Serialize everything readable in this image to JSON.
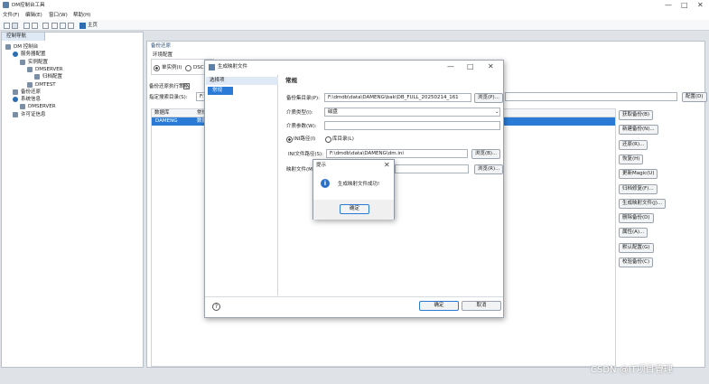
{
  "app": {
    "title": "DM控制台工具",
    "window_buttons": [
      "—",
      "□",
      "✕"
    ]
  },
  "menubar": [
    "文件(F)",
    "编辑(E)",
    "窗口(W)",
    "帮助(H)"
  ],
  "toolbar": {
    "home_label": "主页"
  },
  "nav": {
    "tab_label": "控制导航",
    "tree": [
      {
        "label": "DM 控制台",
        "indent": 0
      },
      {
        "label": "服务器配置",
        "indent": 1
      },
      {
        "label": "实例配置",
        "indent": 2
      },
      {
        "label": "DMSERVER",
        "indent": 3
      },
      {
        "label": "归档配置",
        "indent": 4
      },
      {
        "label": "DMTEST",
        "indent": 3
      },
      {
        "label": "备份还原",
        "indent": 1
      },
      {
        "label": "系统信息",
        "indent": 1
      },
      {
        "label": "DMSERVER",
        "indent": 2
      },
      {
        "label": "许可证信息",
        "indent": 1
      }
    ]
  },
  "backup": {
    "section_title": "备份还原",
    "env_label": "环境配置",
    "radio_single": "单实例(I)",
    "radio_dsc": "DSC(",
    "exec_label": "备份还原执行策略:",
    "dir_label": "指定搜索目录(S):",
    "dir_value": "F:\\",
    "table_headers": [
      "数据库",
      "常规"
    ],
    "table_row": [
      "DAMENG",
      "数据"
    ],
    "config_button": "配置(D)",
    "actions": [
      "获取备份(B)",
      "新建备份(N)...",
      "还原(R)...",
      "恢复(H)",
      "更新Magic(U)",
      "归档修复(F)...",
      "生成映射文件(J)...",
      "删除备份(D)",
      "属性(A)...",
      "默认配置(G)",
      "校验备份(C)"
    ]
  },
  "gen_dialog": {
    "title": "生成映射文件",
    "nav_items": [
      "选择项",
      "常规"
    ],
    "section": "常规",
    "backup_dir_label": "备份集目录(P):",
    "backup_dir_value": "F:\\dmdb\\data\\DAMENG\\bak\\DB_FULL_20250214_161",
    "browse_p": "浏览(P)...",
    "media_type_label": "介质类型(I):",
    "media_type_value": "磁盘",
    "media_param_label": "介质参数(W):",
    "media_param_value": "",
    "radio_ini": "INI路径(I)",
    "radio_lib": "库目录(L)",
    "ini_label": "INI文件路径(S):",
    "ini_value": "F:\\dmdb\\data\\DAMENG\\dm.ini",
    "browse_b": "浏览(B)...",
    "map_label": "映射文件(M)",
    "browse_r": "浏览(R)...",
    "ok": "确定",
    "cancel": "取消"
  },
  "message": {
    "title": "提示",
    "text": "生成映射文件成功!",
    "ok": "确定"
  },
  "watermark": "CSDN @IT项目管理"
}
